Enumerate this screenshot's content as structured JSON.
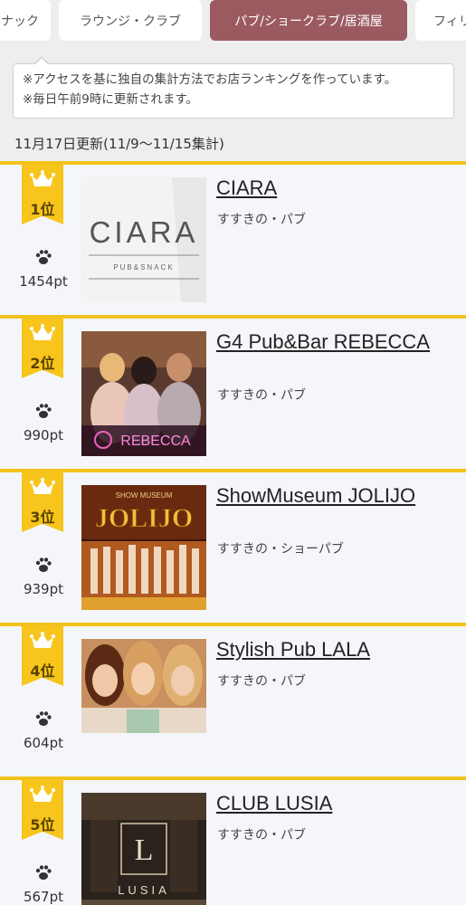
{
  "tabs": [
    {
      "label": "ナック",
      "active": false
    },
    {
      "label": "ラウンジ・クラブ",
      "active": false
    },
    {
      "label": "パブ/ショークラブ/居酒屋",
      "active": true
    },
    {
      "label": "フィリ",
      "active": false
    }
  ],
  "notice": {
    "line1": "※アクセスを基に独自の集計方法でお店ランキングを作っています。",
    "line2": "※毎日午前9時に更新されます。"
  },
  "update_text": "11月17日更新(11/9〜11/15集計)",
  "colors": {
    "accent_gold": "#f7c51c",
    "active_tab": "#9b5a60",
    "card_bg": "#f4f6fb"
  },
  "ranking": [
    {
      "rank": "1位",
      "points": "1454pt",
      "name": "CIARA",
      "category": "すすきの・パブ",
      "thumb_text": "CIARA",
      "thumb_sub": "PUB&SNACK"
    },
    {
      "rank": "2位",
      "points": "990pt",
      "name": "G4 Pub&Bar REBECCA",
      "category": "すすきの・パブ",
      "thumb_text": "REBECCA"
    },
    {
      "rank": "3位",
      "points": "939pt",
      "name": "ShowMuseum JOLIJO",
      "category": "すすきの・ショーパブ",
      "thumb_text": "JOLIJO",
      "thumb_sub": "SHOW MUSEUM"
    },
    {
      "rank": "4位",
      "points": "604pt",
      "name": "Stylish Pub LALA",
      "category": "すすきの・パブ"
    },
    {
      "rank": "5位",
      "points": "567pt",
      "name": "CLUB LUSIA",
      "category": "すすきの・パブ",
      "thumb_text": "LUSIA"
    }
  ]
}
